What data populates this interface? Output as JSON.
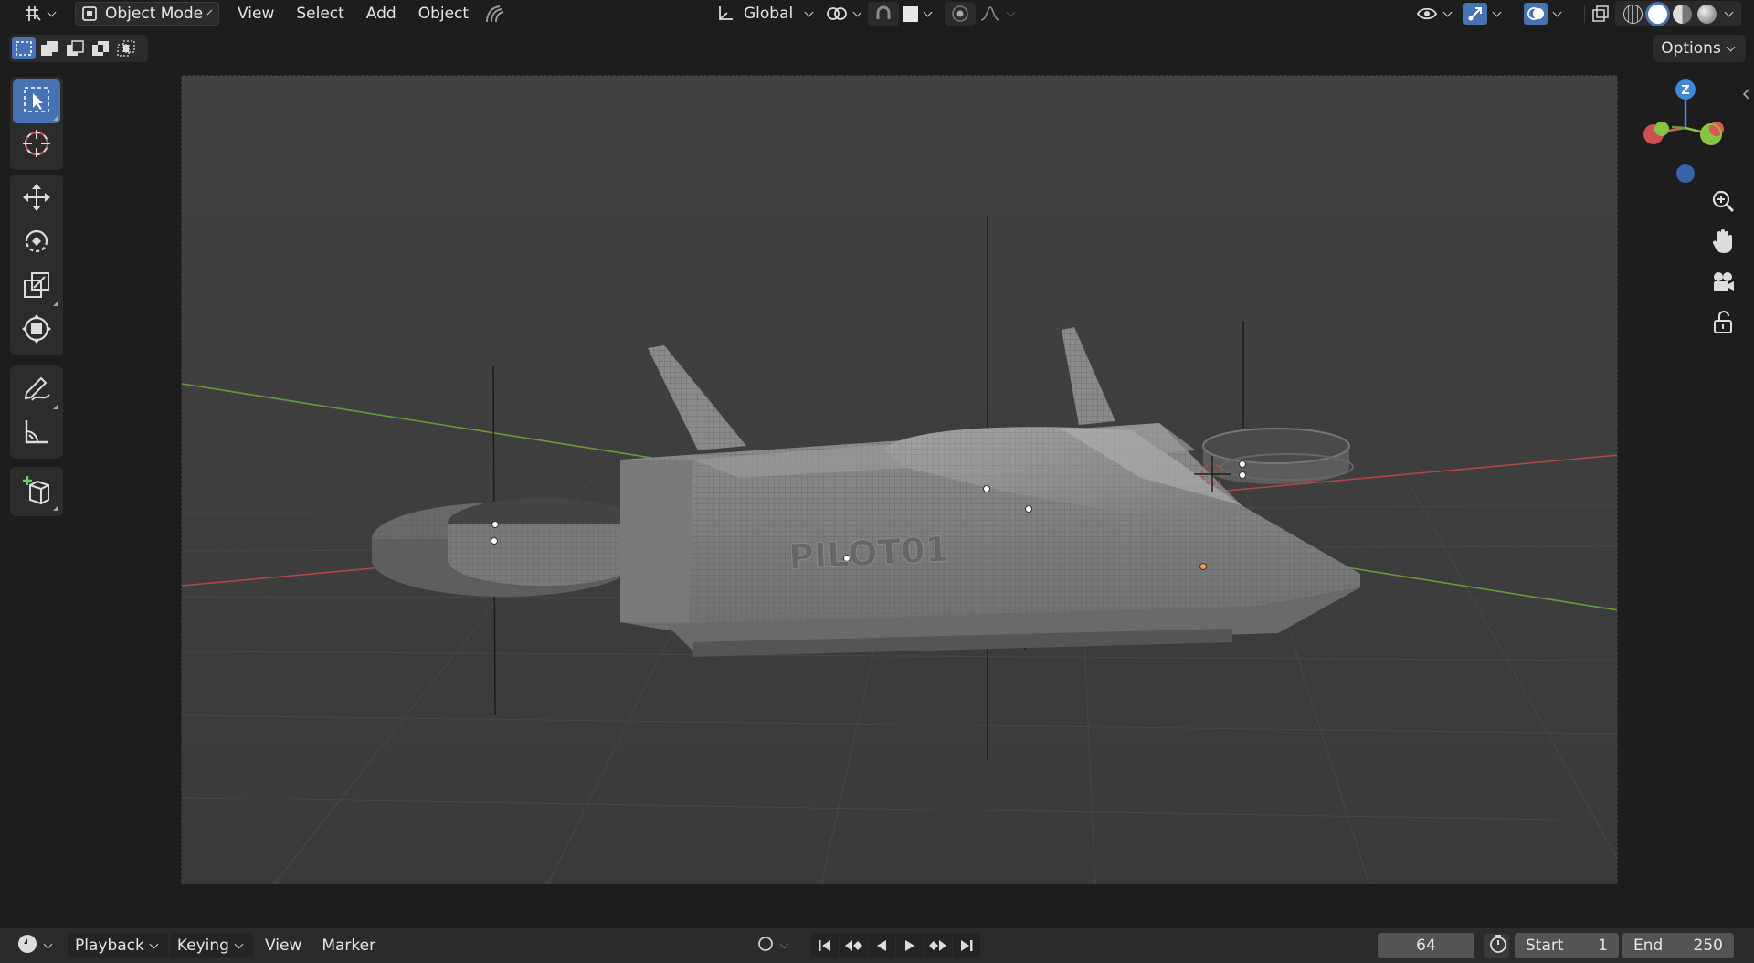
{
  "header": {
    "editor_type_icon": "grid-editor-icon",
    "mode_label": "Object Mode",
    "menus": [
      "View",
      "Select",
      "Add",
      "Object"
    ],
    "transform_orientation": "Global"
  },
  "subheader": {
    "options_label": "Options"
  },
  "viewport": {
    "fuselage_decal": "PILOT01",
    "gizmo": {
      "z_label": "Z",
      "x_color": "#e25555",
      "y_color": "#88c443",
      "z_color": "#3f88d8"
    }
  },
  "toolbar": {
    "tools": [
      "select-box",
      "cursor",
      "move",
      "rotate",
      "scale",
      "transform",
      "annotate",
      "measure",
      "add-cube"
    ]
  },
  "timeline": {
    "menus": {
      "playback": "Playback",
      "keying": "Keying",
      "view": "View",
      "marker": "Marker"
    },
    "current_frame": "64",
    "start_label": "Start",
    "start_value": "1",
    "end_label": "End",
    "end_value": "250"
  },
  "colors": {
    "accent": "#4772b3",
    "background": "#1d1d1d",
    "viewport": "#3d3d3d",
    "x_axis": "#b04646",
    "y_axis": "#6a9a38",
    "origin_selected": "#f2a33a"
  }
}
